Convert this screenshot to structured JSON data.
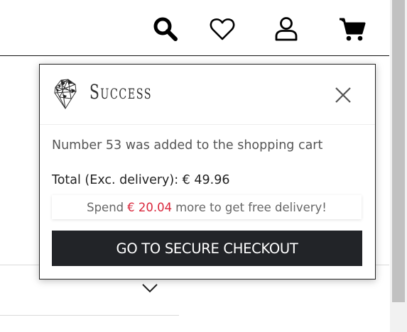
{
  "header": {
    "icons": [
      "search-icon",
      "heart-icon",
      "user-icon",
      "cart-icon"
    ]
  },
  "popup": {
    "title": "Success",
    "message": "Number 53 was added to the shopping cart",
    "total_label": "Total (Exc. delivery): € 49.96",
    "promo": {
      "prefix": "Spend",
      "amount": "€ 20.04",
      "suffix": "more to get free delivery!",
      "amount_color": "#d9263b"
    },
    "checkout_label": "GO TO SECURE CHECKOUT"
  },
  "colors": {
    "checkout_bg": "#222428",
    "text_dark": "#222222"
  }
}
